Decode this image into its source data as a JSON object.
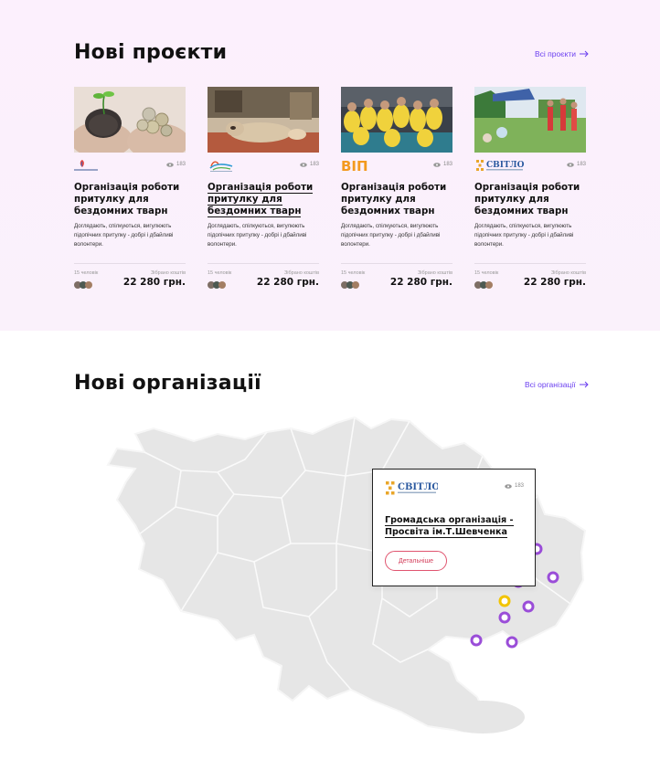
{
  "projects": {
    "title": "Нові проєкти",
    "see_all": "Всі проєкти",
    "cards": [
      {
        "views": "183",
        "title": "Організація роботи притулку для бездомних тварн",
        "description": "Доглядають, спілкуються, вигулюють підопічних притулку - добрі і дбайливі волонтери.",
        "people_label": "15 человік",
        "raised_label": "Зібрано коштів",
        "amount": "22 280 грн."
      },
      {
        "views": "183",
        "title": "Організація роботи притулку для бездомних тварн",
        "description": "Доглядають, спілкуються, вигулюють підопічних притулку - добрі і дбайливі волонтери.",
        "people_label": "15 человік",
        "raised_label": "Зібрано коштів",
        "amount": "22 280 грн."
      },
      {
        "views": "183",
        "logo_text": "ВІП",
        "title": "Організація роботи притулку для бездомних тварн",
        "description": "Доглядають, спілкуються, вигулюють підопічних притулку - добрі і дбайливі волонтери.",
        "people_label": "15 человік",
        "raised_label": "Зібрано коштів",
        "amount": "22 280 грн."
      },
      {
        "views": "183",
        "logo_text": "СВІТЛО",
        "title": "Організація роботи притулку для бездомних тварн",
        "description": "Доглядають, спілкуються, вигулюють підопічних притулку - добрі і дбайливі волонтери.",
        "people_label": "15 человік",
        "raised_label": "Зібрано коштів",
        "amount": "22 280 грн."
      }
    ]
  },
  "organizations": {
    "title": "Нові організації",
    "see_all": "Всі організації",
    "popup": {
      "logo_text": "СВІТЛО",
      "views": "183",
      "title": "Громадська організація - Просвіта ім.Т.Шевченка",
      "button": "Детальніше"
    }
  },
  "colors": {
    "accent": "#6b3ff0",
    "marker": "#9a4dd8",
    "marker_active": "#f2c400",
    "button_border": "#e0546f",
    "section_bg": "#fcf0fd"
  },
  "icons": {
    "arrow": "arrow-right-icon",
    "eye": "eye-icon"
  }
}
